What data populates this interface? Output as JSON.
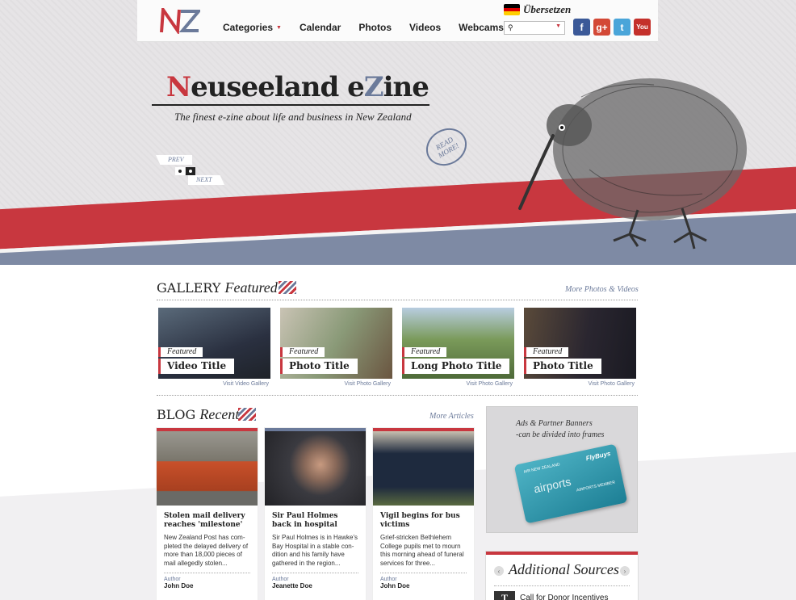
{
  "brand": {
    "logo_text": "NZ",
    "title_n": "N",
    "title_mid": "euseeland e",
    "title_z": "Z",
    "title_end": "ine",
    "tagline": "The finest e-zine about life and business in New Zealand"
  },
  "nav": {
    "items": [
      {
        "label": "Categories",
        "has_dropdown": true
      },
      {
        "label": "Calendar"
      },
      {
        "label": "Photos"
      },
      {
        "label": "Videos"
      },
      {
        "label": "Webcams"
      }
    ],
    "translate_label": "Übersetzen",
    "search_placeholder": ""
  },
  "social": [
    {
      "name": "facebook-icon",
      "glyph": "f",
      "color": "#3b5998"
    },
    {
      "name": "google-plus-icon",
      "glyph": "g+",
      "color": "#d34836"
    },
    {
      "name": "twitter-icon",
      "glyph": "t",
      "color": "#4aa5d9"
    },
    {
      "name": "youtube-icon",
      "glyph": "You",
      "color": "#c4302b"
    }
  ],
  "hero": {
    "read_more": "READ MORE!",
    "prev": "PREV",
    "next": "NEXT",
    "slides": 2,
    "active_slide": 2
  },
  "gallery": {
    "title": "GALLERY",
    "title_em": "Featured",
    "more_link": "More Photos & Videos",
    "items": [
      {
        "tag": "Featured",
        "title": "Video Title",
        "visit": "Visit Video Gallery",
        "bg": "#3a4452"
      },
      {
        "tag": "Featured",
        "title": "Photo Title",
        "visit": "Visit Photo Gallery",
        "bg": "#7a8a6a"
      },
      {
        "tag": "Featured",
        "title": "Long Photo Title",
        "visit": "Visit Photo Gallery",
        "bg": "#5e7a4a"
      },
      {
        "tag": "Featured",
        "title": "Photo Title",
        "visit": "Visit Photo Gallery",
        "bg": "#2e2a34"
      }
    ]
  },
  "blog": {
    "title": "BLOG",
    "title_em": "Recent",
    "more_link": "More Articles",
    "author_label": "Author",
    "posts": [
      {
        "title": "Stolen mail delivery reaches 'milestone'",
        "body": "New Zealand Post has com-pleted the delayed delivery of more than 18,000 pieces of mail allegedly stolen...",
        "author": "John Doe",
        "accent": "#c8373f",
        "bg": "#8a8678"
      },
      {
        "title": "Sir Paul Holmes back in hospital",
        "body": "Sir Paul Holmes is in Hawke's Bay Hospital in a stable con-dition and his family have gathered in the region...",
        "author": "Jeanette Doe",
        "accent": "#6b7a9a",
        "bg": "#4a4a50"
      },
      {
        "title": "Vigil begins for bus victims",
        "body": "Grief-stricken Bethlehem College pupils met to mourn this morning ahead of funeral services for three...",
        "author": "John Doe",
        "accent": "#c8373f",
        "bg": "#3b4a5e"
      }
    ]
  },
  "ads": {
    "line1": "Ads & Partner Banners",
    "line2": "-can be divided into frames",
    "card_top": "AIR NEW ZEALAND",
    "card_brand": "FlyBuys",
    "card_airports": "airports",
    "card_member": "AIRPORTS MEMBER"
  },
  "additional": {
    "title": "Additional Sources",
    "items": [
      {
        "icon": "T",
        "label": "Call for Donor Incentives"
      }
    ]
  },
  "colors": {
    "red": "#c8373f",
    "blue": "#6b7a9a",
    "slate": "#7e8aa4"
  }
}
